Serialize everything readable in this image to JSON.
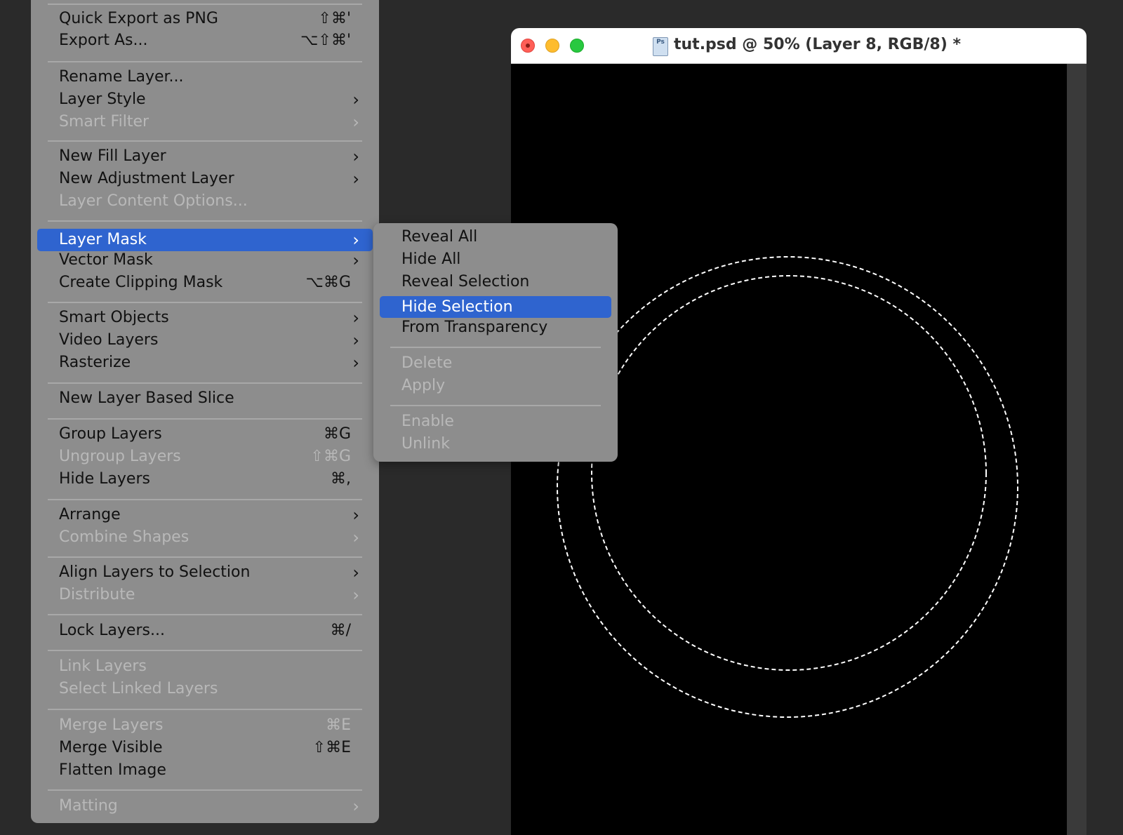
{
  "document": {
    "title": "tut.psd @ 50% (Layer 8, RGB/8) *",
    "icon": "photoshop-file-icon",
    "icon_text": "Ps"
  },
  "main_menu": [
    {
      "label": "Quick Export as PNG",
      "shortcut": "⇧⌘'",
      "submenu": false,
      "disabled": false
    },
    {
      "label": "Export As...",
      "shortcut": "⌥⇧⌘'",
      "submenu": false,
      "disabled": false
    },
    {
      "label": "Rename Layer...",
      "shortcut": "",
      "submenu": false,
      "disabled": false
    },
    {
      "label": "Layer Style",
      "shortcut": "",
      "submenu": true,
      "disabled": false
    },
    {
      "label": "Smart Filter",
      "shortcut": "",
      "submenu": true,
      "disabled": true
    },
    {
      "label": "New Fill Layer",
      "shortcut": "",
      "submenu": true,
      "disabled": false
    },
    {
      "label": "New Adjustment Layer",
      "shortcut": "",
      "submenu": true,
      "disabled": false
    },
    {
      "label": "Layer Content Options...",
      "shortcut": "",
      "submenu": false,
      "disabled": true
    },
    {
      "label": "Layer Mask",
      "shortcut": "",
      "submenu": true,
      "disabled": false,
      "highlighted": true
    },
    {
      "label": "Vector Mask",
      "shortcut": "",
      "submenu": true,
      "disabled": false
    },
    {
      "label": "Create Clipping Mask",
      "shortcut": "⌥⌘G",
      "submenu": false,
      "disabled": false
    },
    {
      "label": "Smart Objects",
      "shortcut": "",
      "submenu": true,
      "disabled": false
    },
    {
      "label": "Video Layers",
      "shortcut": "",
      "submenu": true,
      "disabled": false
    },
    {
      "label": "Rasterize",
      "shortcut": "",
      "submenu": true,
      "disabled": false
    },
    {
      "label": "New Layer Based Slice",
      "shortcut": "",
      "submenu": false,
      "disabled": false
    },
    {
      "label": "Group Layers",
      "shortcut": "⌘G",
      "submenu": false,
      "disabled": false
    },
    {
      "label": "Ungroup Layers",
      "shortcut": "⇧⌘G",
      "submenu": false,
      "disabled": true
    },
    {
      "label": "Hide Layers",
      "shortcut": "⌘,",
      "submenu": false,
      "disabled": false
    },
    {
      "label": "Arrange",
      "shortcut": "",
      "submenu": true,
      "disabled": false
    },
    {
      "label": "Combine Shapes",
      "shortcut": "",
      "submenu": true,
      "disabled": true
    },
    {
      "label": "Align Layers to Selection",
      "shortcut": "",
      "submenu": true,
      "disabled": false
    },
    {
      "label": "Distribute",
      "shortcut": "",
      "submenu": true,
      "disabled": true
    },
    {
      "label": "Lock Layers...",
      "shortcut": "⌘/",
      "submenu": false,
      "disabled": false
    },
    {
      "label": "Link Layers",
      "shortcut": "",
      "submenu": false,
      "disabled": true
    },
    {
      "label": "Select Linked Layers",
      "shortcut": "",
      "submenu": false,
      "disabled": true
    },
    {
      "label": "Merge Layers",
      "shortcut": "⌘E",
      "submenu": false,
      "disabled": true
    },
    {
      "label": "Merge Visible",
      "shortcut": "⇧⌘E",
      "submenu": false,
      "disabled": false
    },
    {
      "label": "Flatten Image",
      "shortcut": "",
      "submenu": false,
      "disabled": false
    },
    {
      "label": "Matting",
      "shortcut": "",
      "submenu": true,
      "disabled": true
    }
  ],
  "layer_mask_submenu": [
    {
      "label": "Reveal All",
      "disabled": false
    },
    {
      "label": "Hide All",
      "disabled": false
    },
    {
      "label": "Reveal Selection",
      "disabled": false
    },
    {
      "label": "Hide Selection",
      "disabled": false,
      "highlighted": true
    },
    {
      "label": "From Transparency",
      "disabled": false
    },
    {
      "label": "Delete",
      "disabled": true
    },
    {
      "label": "Apply",
      "disabled": true
    },
    {
      "label": "Enable",
      "disabled": true
    },
    {
      "label": "Unlink",
      "disabled": true
    }
  ],
  "colors": {
    "menu_bg": "#8d8d8d",
    "highlight": "#2f64cf",
    "canvas": "#000000",
    "selection": "#ffffff"
  }
}
